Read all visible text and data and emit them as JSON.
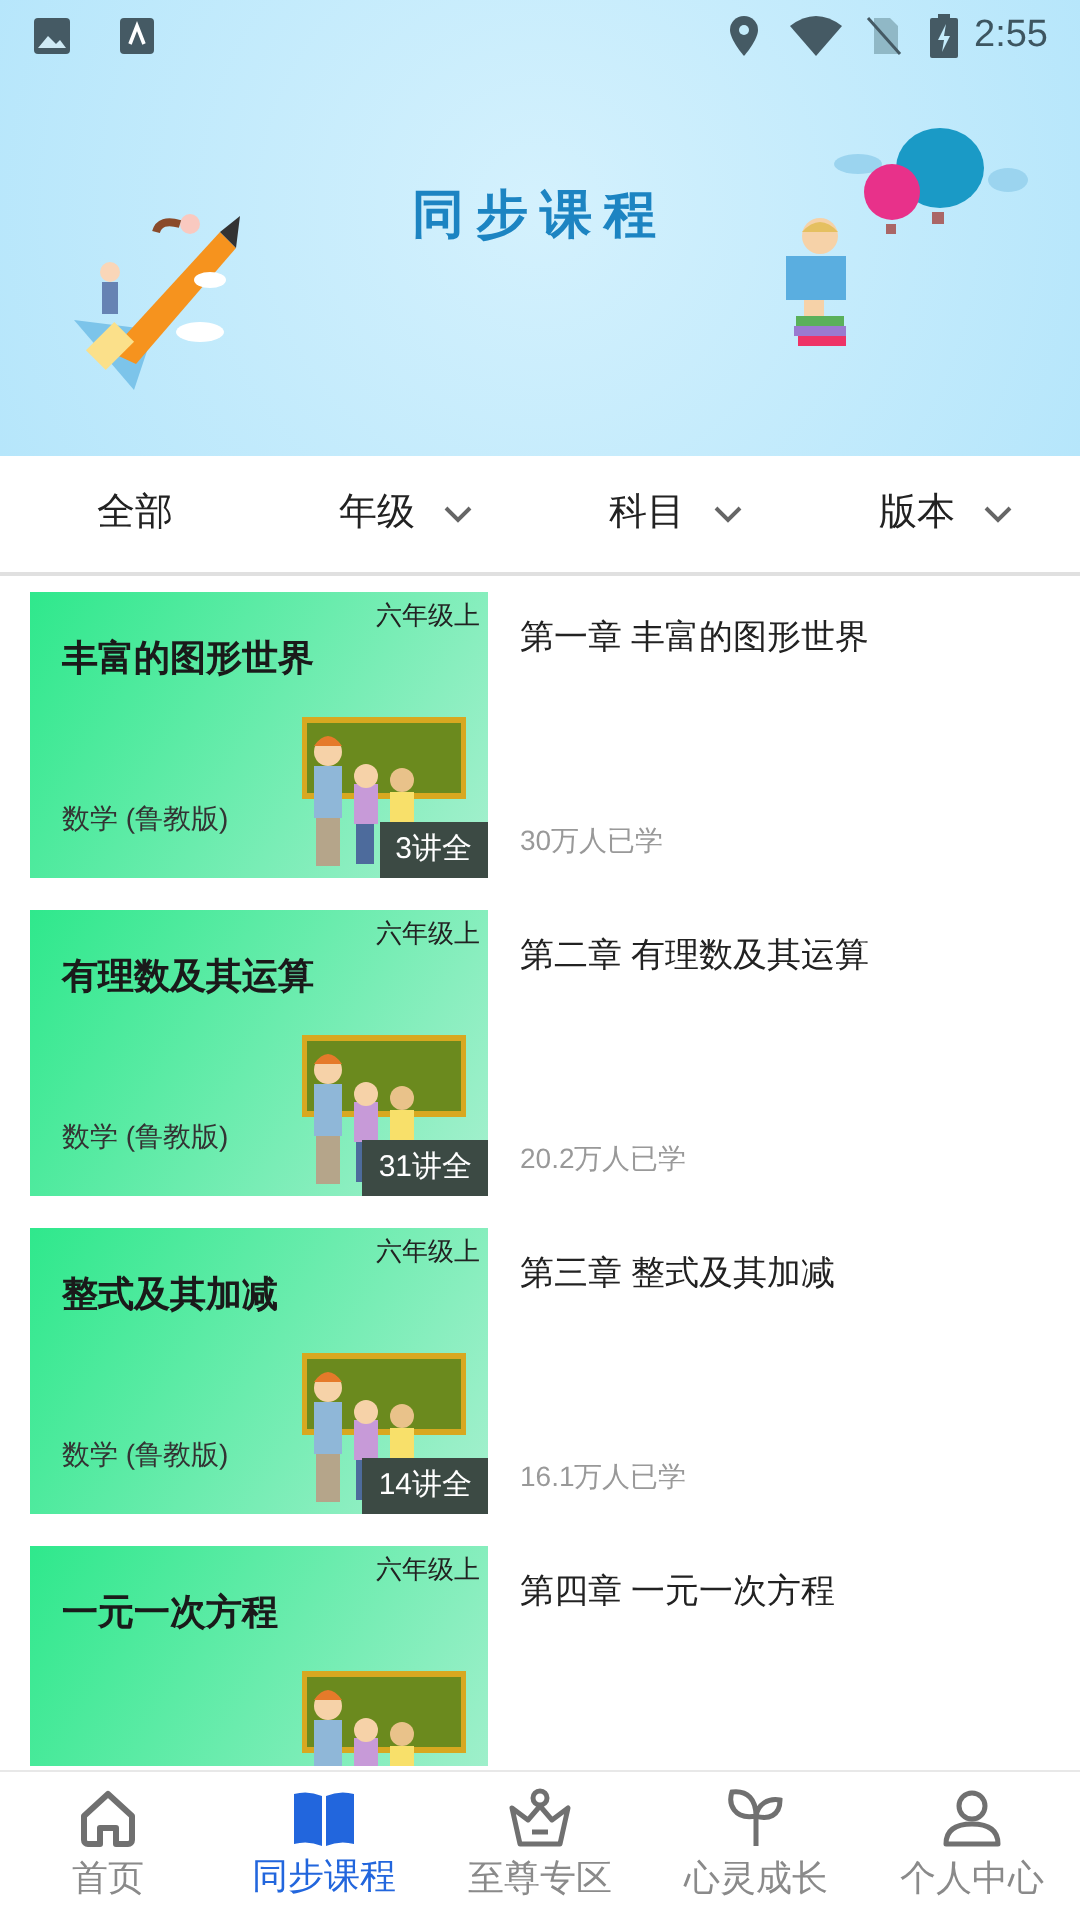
{
  "status_bar": {
    "time": "2:55"
  },
  "banner": {
    "title": "同步课程"
  },
  "filters": [
    {
      "label": "全部",
      "dropdown": false
    },
    {
      "label": "年级",
      "dropdown": true
    },
    {
      "label": "科目",
      "dropdown": true
    },
    {
      "label": "版本",
      "dropdown": true
    }
  ],
  "courses": [
    {
      "cover_title": "丰富的图形世界",
      "grade": "六年级上",
      "subject": "数学 (鲁教版)",
      "lessons": "3讲全",
      "title": "第一章 丰富的图形世界",
      "learners": "30万人已学"
    },
    {
      "cover_title": "有理数及其运算",
      "grade": "六年级上",
      "subject": "数学 (鲁教版)",
      "lessons": "31讲全",
      "title": "第二章 有理数及其运算",
      "learners": "20.2万人已学"
    },
    {
      "cover_title": "整式及其加减",
      "grade": "六年级上",
      "subject": "数学 (鲁教版)",
      "lessons": "14讲全",
      "title": "第三章 整式及其加减",
      "learners": "16.1万人已学"
    },
    {
      "cover_title": "一元一次方程",
      "grade": "六年级上",
      "title": "第四章 一元一次方程"
    }
  ],
  "bottom_nav": [
    {
      "label": "首页",
      "selected": false
    },
    {
      "label": "同步课程",
      "selected": true
    },
    {
      "label": "至尊专区",
      "selected": false
    },
    {
      "label": "心灵成长",
      "selected": false
    },
    {
      "label": "个人中心",
      "selected": false
    }
  ]
}
